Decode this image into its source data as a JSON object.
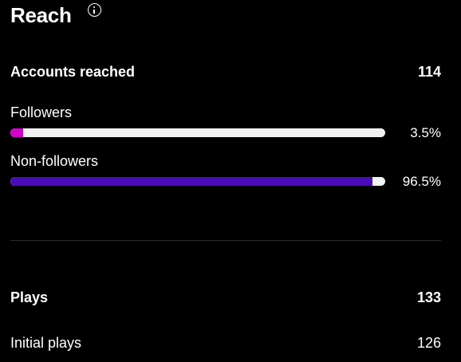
{
  "header": {
    "title": "Reach",
    "info_icon": "info-icon"
  },
  "accounts_reached": {
    "label": "Accounts reached",
    "value": "114"
  },
  "followers": {
    "label": "Followers",
    "percent_label": "3.5%",
    "fraction": 0.035,
    "color": "#d400c8"
  },
  "non_followers": {
    "label": "Non-followers",
    "percent_label": "96.5%",
    "fraction": 0.965,
    "color": "#4a0bb8"
  },
  "plays": {
    "label": "Plays",
    "value": "133"
  },
  "initial_plays": {
    "label": "Initial plays",
    "value": "126"
  },
  "colors": {
    "background": "#000000",
    "track": "#f2f2f2",
    "text": "#ffffff"
  }
}
